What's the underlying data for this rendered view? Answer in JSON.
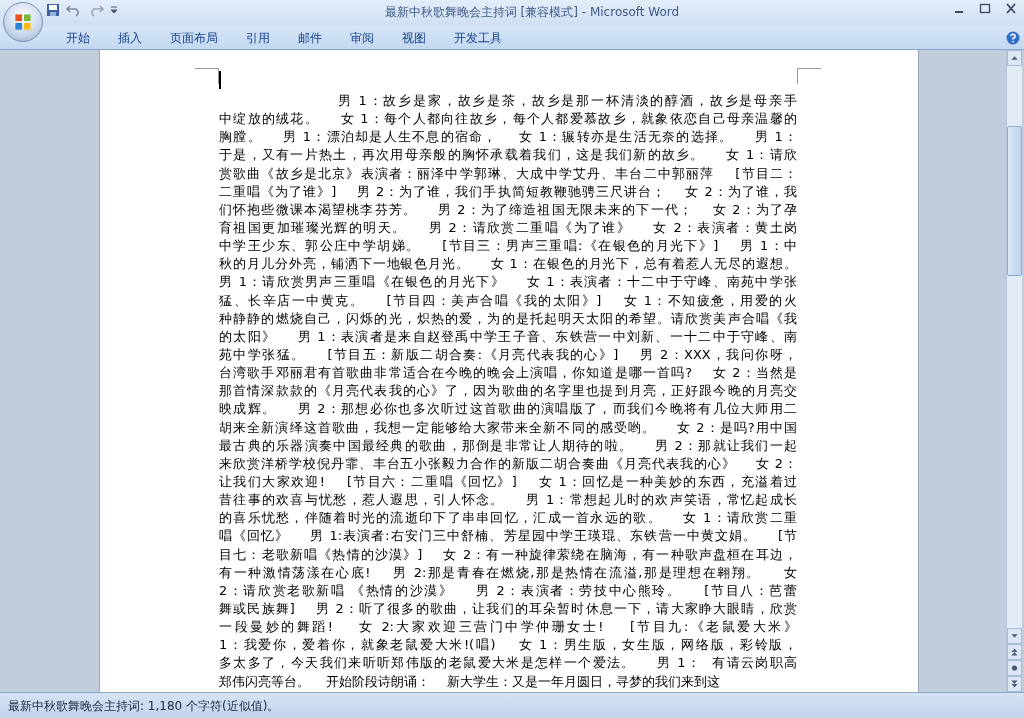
{
  "window": {
    "title": "最新中秋歌舞晚会主持词 [兼容模式] - Microsoft Word"
  },
  "ribbon_tabs": [
    "开始",
    "插入",
    "页面布局",
    "引用",
    "邮件",
    "审阅",
    "视图",
    "开发工具"
  ],
  "document": {
    "lines": [
      "                    男 1：故乡是家，故乡是茶，故乡是那一杯清淡的醇酒，故乡是母亲手",
      "中绽放的绒花。    女 1：每个人都向往故乡，每个人都爱慕故乡，就象依恋自己母亲温馨的",
      "胸膛。    男 1：漂泊却是人生不息的宿命，    女 1：辗转亦是生活无奈的选择。    男 1：",
      "于是，又有一片热土，再次用母亲般的胸怀承载着我们，这是我们新的故乡。    女 1：请欣",
      "赏歌曲《故乡是北京》表演者：丽泽中学郭琳、大成中学艾丹、丰台二中郭丽萍    [节目二：",
      "二重唱《为了谁》]    男 2：为了谁，我们手执简短教鞭驰骋三尺讲台；    女 2：为了谁，我",
      "们怀抱些微课本渴望桃李芬芳。    男 2：为了缔造祖国无限未来的下一代；    女 2：为了孕",
      "育祖国更加璀璨光辉的明天。    男 2：请欣赏二重唱《为了谁》    女 2：表演者：黄土岗",
      "中学王少东、郭公庄中学胡娣。    [节目三：男声三重唱:《在银色的月光下》]    男 1：中",
      "秋的月儿分外亮，铺洒下一地银色月光。    女 1：在银色的月光下，总有着惹人无尽的遐想。",
      "男 1：请欣赏男声三重唱《在银色的月光下》    女 1：表演者：十二中于守峰、南苑中学张",
      "猛、长辛店一中黄克。    [节目四：美声合唱《我的太阳》]    女 1：不知疲惫，用爱的火",
      "种静静的燃烧自己，闪烁的光，炽热的爱，为的是托起明天太阳的希望。请欣赏美声合唱《我",
      "的太阳》    男 1：表演者是来自赵登禹中学王子音、东铁营一中刘新、一十二中于守峰、南",
      "苑中学张猛。    [节目五：新版二胡合奏:《月亮代表我的心》]    男 2：XXX，我问你呀，",
      "台湾歌手邓丽君有首歌曲非常适合在今晚的晚会上演唱，你知道是哪一首吗?    女 2：当然是",
      "那首情深款款的《月亮代表我的心》了，因为歌曲的名字里也提到月亮，正好跟今晚的月亮交",
      "映成辉。    男 2：那想必你也多次听过这首歌曲的演唱版了，而我们今晚将有几位大师用二",
      "胡来全新演绎这首歌曲，我想一定能够给大家带来全新不同的感受哟。    女 2：是吗?用中国",
      "最古典的乐器演奏中国最经典的歌曲，那倒是非常让人期待的啦。    男 2：那就让我们一起",
      "来欣赏洋桥学校倪丹霏、丰台五小张毅力合作的新版二胡合奏曲《月亮代表我的心》    女 2：",
      "让我们大家欢迎!    [节目六：二重唱《回忆》]    女 1：回忆是一种美妙的东西，充溢着过",
      "昔往事的欢喜与忧愁，惹人遐思，引人怀念。    男 1：常想起儿时的欢声笑语，常忆起成长",
      "的喜乐忧愁，伴随着时光的流逝印下了串串回忆，汇成一首永远的歌。    女 1：请欣赏二重",
      "唱《回忆》    男 1:表演者:右安门三中舒楠、芳星园中学王瑛琨、东铁营一中黄文娟。    [节",
      "目七：老歌新唱《热情的沙漠》]    女 2：有一种旋律萦绕在脑海，有一种歌声盘桓在耳边，",
      "有一种激情荡漾在心底!    男 2:那是青春在燃烧,那是热情在流溢,那是理想在翱翔。    女",
      "2：请欣赏老歌新唱 《热情的沙漠》    男 2：表演者：劳技中心熊玲。    [节目八：芭蕾",
      "舞或民族舞]    男 2：听了很多的歌曲，让我们的耳朵暂时休息一下，请大家睁大眼睛，欣赏",
      "一段曼妙的舞蹈!    女 2:大家欢迎三营门中学仲珊女士!    [节目九:《老鼠爱大米》",
      "1：我爱你，爱着你，就象老鼠爱大米!(唱)    女 1：男生版，女生版，网络版，彩铃版，",
      "多太多了，今天我们来听听郑伟版的老鼠爱大米是怎样一个爱法。    男 1：  有请云岗职高",
      "郑伟闪亮等台。    开始阶段诗朗诵：    新大学生：又是一年月圆日，寻梦的我们来到这"
    ]
  },
  "status_bar": {
    "text": "最新中秋歌舞晚会主持词: 1,180 个字符(近似值)。"
  }
}
